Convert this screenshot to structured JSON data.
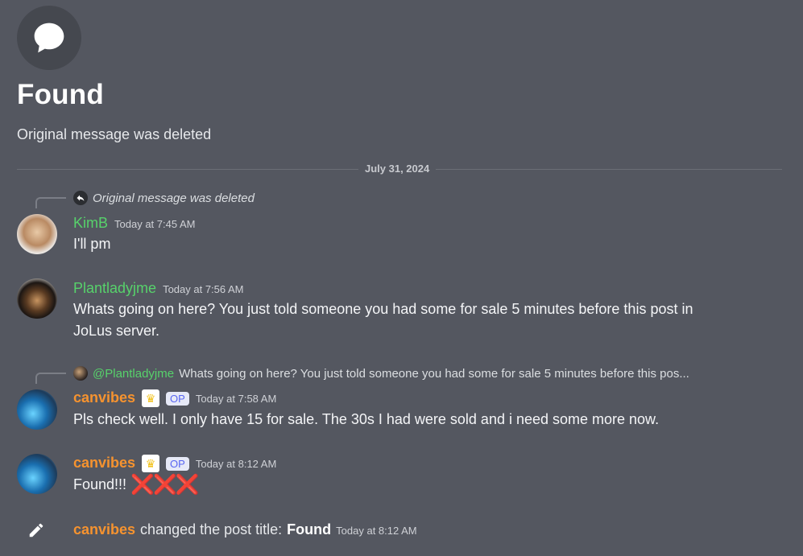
{
  "header": {
    "title": "Found",
    "subtitle": "Original message was deleted",
    "icon": "chat-bubble-icon"
  },
  "date_divider": "July 31, 2024",
  "messages": [
    {
      "reply": {
        "text": "Original message was deleted"
      },
      "author": "KimB",
      "time": "Today at 7:45 AM",
      "text": "I'll pm"
    },
    {
      "author": "Plantladyjme",
      "time": "Today at 7:56 AM",
      "text_line1": "Whats going on here? You just told someone you had some for sale 5 minutes before this post in",
      "text_line2": "JoLus server."
    },
    {
      "reply": {
        "mention": "@Plantladyjme",
        "text": "Whats going on here? You just told someone you had some for sale 5 minutes before this pos..."
      },
      "author": "canvibes",
      "badge_op": "OP",
      "time": "Today at 7:58 AM",
      "text": "Pls check well. I only have 15 for sale. The 30s I had were sold and i need some more now."
    },
    {
      "author": "canvibes",
      "badge_op": "OP",
      "time": "Today at 8:12 AM",
      "text": "Found!!!",
      "emoji": "❌❌❌"
    }
  ],
  "system_message": {
    "author": "canvibes",
    "action": "changed the post title:",
    "new_title": "Found",
    "time": "Today at 8:12 AM"
  },
  "colors": {
    "background": "#545760",
    "green_name": "#57d26b",
    "orange_name": "#f6932f",
    "op_badge": "#5865f2"
  }
}
